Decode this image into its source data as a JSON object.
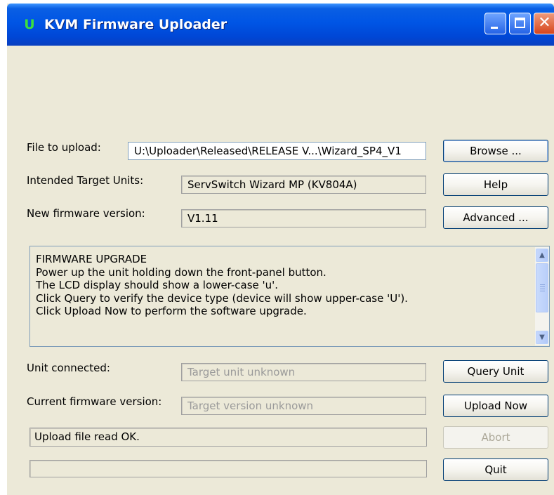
{
  "window": {
    "title": "KVM Firmware Uploader",
    "app_icon_glyph": "U",
    "controls": {
      "minimize": "minimize-icon",
      "maximize": "maximize-icon",
      "close": "close-icon",
      "close_glyph": "✕"
    }
  },
  "colors": {
    "titlebar": "#0055e5",
    "window_bg": "#ece9d8",
    "close_button": "#d6451c",
    "disabled_text": "#9a9a9a"
  },
  "form": {
    "file": {
      "label": "File to upload:",
      "value": "U:\\Uploader\\Released\\RELEASE V...\\Wizard_SP4_V1"
    },
    "target_units": {
      "label": "Intended Target Units:",
      "value": "ServSwitch Wizard MP (KV804A)"
    },
    "new_firmware": {
      "label": "New firmware version:",
      "value": "V1.11"
    }
  },
  "buttons": {
    "browse": "Browse ...",
    "help": "Help",
    "advanced": "Advanced ...",
    "query_unit": "Query Unit",
    "upload_now": "Upload Now",
    "abort": "Abort",
    "quit": "Quit"
  },
  "instructions": {
    "lines": [
      "FIRMWARE UPGRADE",
      "Power up the unit holding down the front-panel button.",
      "The LCD display should show a lower-case 'u'.",
      "Click Query to verify the device type (device will show upper-case 'U').",
      "Click Upload Now to perform the software upgrade."
    ],
    "scroll_up_glyph": "▲",
    "scroll_down_glyph": "▼"
  },
  "status": {
    "unit_connected": {
      "label": "Unit connected:",
      "value": "Target unit unknown"
    },
    "current_firmware": {
      "label": "Current firmware version:",
      "value": "Target version unknown"
    },
    "message": "Upload file read OK.",
    "progress": 0
  }
}
